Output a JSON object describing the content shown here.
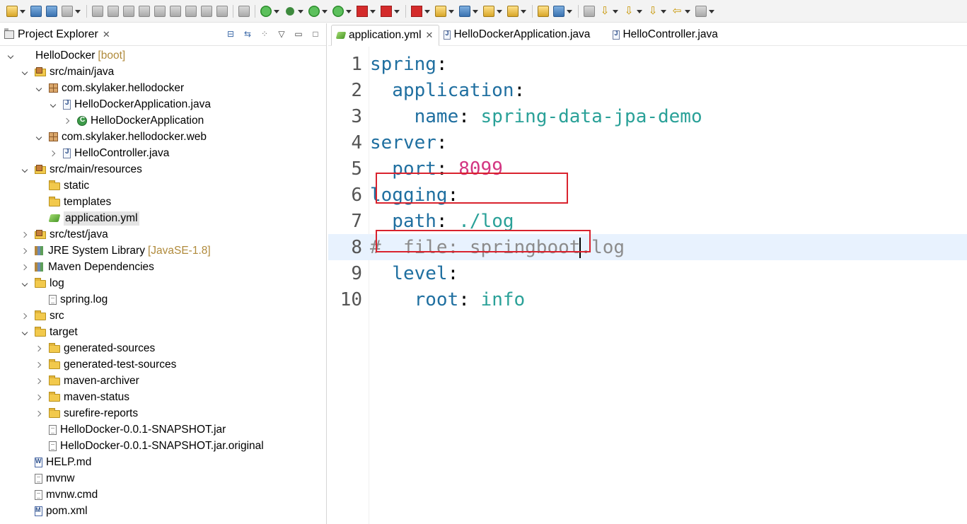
{
  "toolbar": {
    "icons": [
      "new-icon",
      "save-icon",
      "save-all-icon",
      "print-icon",
      "skip-breakpoints-icon",
      "resume-icon",
      "suspend-icon",
      "terminate-icon",
      "disconnect-icon",
      "step-into-icon",
      "step-over-icon",
      "step-return-icon",
      "drop-to-frame-icon",
      "use-step-filters-icon",
      "spring-boot-icon",
      "debug-icon",
      "run-icon",
      "coverage-icon",
      "external-tools-icon",
      "stop-icon",
      "launch-server-icon",
      "new-java-project-icon",
      "new-java-class-icon",
      "open-type-icon",
      "open-task-icon",
      "search-icon",
      "web-browser-icon",
      "toggle-annotation-icon",
      "next-annotation-icon",
      "previous-annotation-icon",
      "last-edit-icon",
      "back-icon",
      "forward-icon"
    ]
  },
  "explorer": {
    "title": "Project Explorer",
    "close": "✕",
    "tree": [
      {
        "label": "HelloDocker",
        "deco": "[boot]",
        "icon": "project",
        "depth": 0,
        "state": "open"
      },
      {
        "label": "src/main/java",
        "icon": "srcfolder",
        "depth": 1,
        "state": "open"
      },
      {
        "label": "com.skylaker.hellodocker",
        "icon": "pkg",
        "depth": 2,
        "state": "open"
      },
      {
        "label": "HelloDockerApplication.java",
        "icon": "java",
        "depth": 3,
        "state": "open"
      },
      {
        "label": "HelloDockerApplication",
        "icon": "cls",
        "depth": 4,
        "state": "closed"
      },
      {
        "label": "com.skylaker.hellodocker.web",
        "icon": "pkg",
        "depth": 2,
        "state": "open"
      },
      {
        "label": "HelloController.java",
        "icon": "java",
        "depth": 3,
        "state": "closed"
      },
      {
        "label": "src/main/resources",
        "icon": "srcfolder",
        "depth": 1,
        "state": "open"
      },
      {
        "label": "static",
        "icon": "folder",
        "depth": 2,
        "state": "none"
      },
      {
        "label": "templates",
        "icon": "folder",
        "depth": 2,
        "state": "none"
      },
      {
        "label": "application.yml",
        "icon": "yml",
        "depth": 2,
        "state": "none",
        "selected": true
      },
      {
        "label": "src/test/java",
        "icon": "srcfolder",
        "depth": 1,
        "state": "closed"
      },
      {
        "label": "JRE System Library",
        "deco": "[JavaSE-1.8]",
        "icon": "lib",
        "depth": 1,
        "state": "closed"
      },
      {
        "label": "Maven Dependencies",
        "icon": "lib",
        "depth": 1,
        "state": "closed"
      },
      {
        "label": "log",
        "icon": "folder",
        "depth": 1,
        "state": "open"
      },
      {
        "label": "spring.log",
        "icon": "file",
        "depth": 2,
        "state": "none"
      },
      {
        "label": "src",
        "icon": "folder",
        "depth": 1,
        "state": "closed"
      },
      {
        "label": "target",
        "icon": "folder",
        "depth": 1,
        "state": "open"
      },
      {
        "label": "generated-sources",
        "icon": "folder",
        "depth": 2,
        "state": "closed"
      },
      {
        "label": "generated-test-sources",
        "icon": "folder",
        "depth": 2,
        "state": "closed"
      },
      {
        "label": "maven-archiver",
        "icon": "folder",
        "depth": 2,
        "state": "closed"
      },
      {
        "label": "maven-status",
        "icon": "folder",
        "depth": 2,
        "state": "closed"
      },
      {
        "label": "surefire-reports",
        "icon": "folder",
        "depth": 2,
        "state": "closed"
      },
      {
        "label": "HelloDocker-0.0.1-SNAPSHOT.jar",
        "icon": "file",
        "depth": 2,
        "state": "none"
      },
      {
        "label": "HelloDocker-0.0.1-SNAPSHOT.jar.original",
        "icon": "file",
        "depth": 2,
        "state": "none"
      },
      {
        "label": "HELP.md",
        "icon": "docw",
        "depth": 1,
        "state": "none"
      },
      {
        "label": "mvnw",
        "icon": "file",
        "depth": 1,
        "state": "none"
      },
      {
        "label": "mvnw.cmd",
        "icon": "file",
        "depth": 1,
        "state": "none"
      },
      {
        "label": "pom.xml",
        "icon": "docm",
        "depth": 1,
        "state": "none"
      }
    ]
  },
  "editor": {
    "tabs": [
      {
        "label": "application.yml",
        "icon": "yml",
        "active": true,
        "close": "✕"
      },
      {
        "label": "HelloDockerApplication.java",
        "icon": "java",
        "active": false
      },
      {
        "label": "HelloController.java",
        "icon": "java",
        "active": false
      }
    ],
    "lines": [
      {
        "num": "1",
        "tokens": [
          {
            "t": "spring",
            "c": "k"
          },
          {
            "t": ":",
            "c": "p"
          }
        ]
      },
      {
        "num": "2",
        "tokens": [
          {
            "t": "  application",
            "c": "k"
          },
          {
            "t": ":",
            "c": "p"
          }
        ]
      },
      {
        "num": "3",
        "tokens": [
          {
            "t": "    name",
            "c": "k"
          },
          {
            "t": ": ",
            "c": "p"
          },
          {
            "t": "spring-data-jpa-demo",
            "c": "v"
          }
        ]
      },
      {
        "num": "4",
        "tokens": [
          {
            "t": "server",
            "c": "k"
          },
          {
            "t": ":",
            "c": "p"
          }
        ]
      },
      {
        "num": "5",
        "tokens": [
          {
            "t": "  port",
            "c": "k"
          },
          {
            "t": ": ",
            "c": "p"
          },
          {
            "t": "8099",
            "c": "n"
          }
        ]
      },
      {
        "num": "6",
        "tokens": [
          {
            "t": "logging",
            "c": "k"
          },
          {
            "t": ":",
            "c": "p"
          }
        ]
      },
      {
        "num": "7",
        "tokens": [
          {
            "t": "  path",
            "c": "k"
          },
          {
            "t": ": ",
            "c": "p"
          },
          {
            "t": "./log",
            "c": "v"
          }
        ]
      },
      {
        "num": "8",
        "current": true,
        "tokens": [
          {
            "t": "#  file: springboot",
            "c": "c"
          },
          {
            "t": "",
            "c": "caret"
          },
          {
            "t": ".log",
            "c": "c"
          }
        ]
      },
      {
        "num": "9",
        "tokens": [
          {
            "t": "  level",
            "c": "k"
          },
          {
            "t": ":",
            "c": "p"
          }
        ]
      },
      {
        "num": "10",
        "tokens": [
          {
            "t": "    root",
            "c": "k"
          },
          {
            "t": ": ",
            "c": "p"
          },
          {
            "t": "info",
            "c": "v"
          }
        ]
      }
    ],
    "highlight_color": "#d9232e"
  }
}
